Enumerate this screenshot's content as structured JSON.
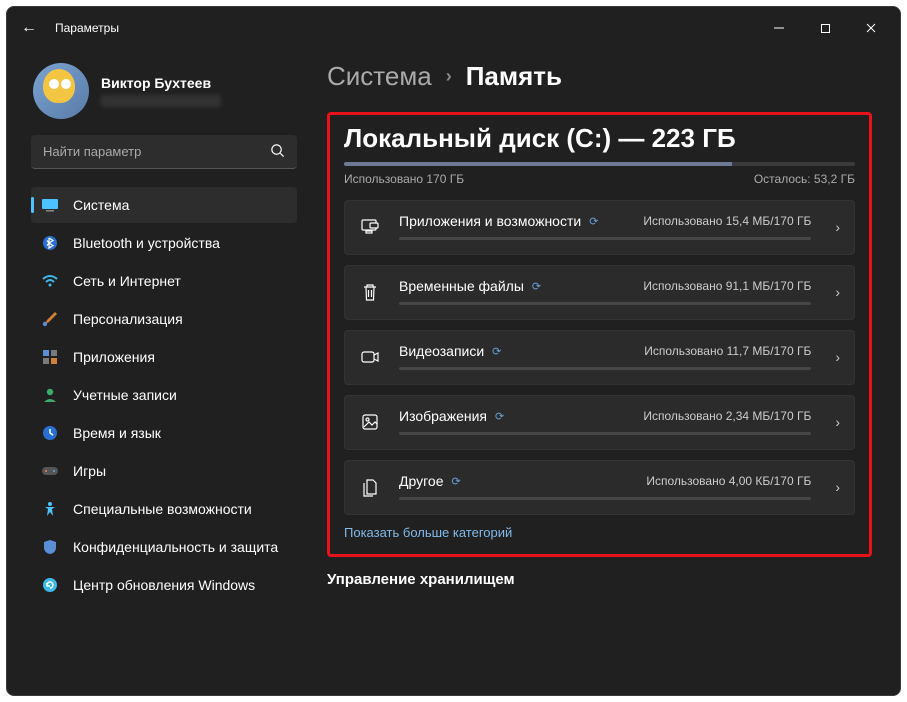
{
  "titlebar": {
    "title": "Параметры"
  },
  "profile": {
    "name": "Виктор Бухтеев"
  },
  "search": {
    "placeholder": "Найти параметр"
  },
  "sidebar": {
    "items": [
      {
        "label": "Система"
      },
      {
        "label": "Bluetooth и устройства"
      },
      {
        "label": "Сеть и Интернет"
      },
      {
        "label": "Персонализация"
      },
      {
        "label": "Приложения"
      },
      {
        "label": "Учетные записи"
      },
      {
        "label": "Время и язык"
      },
      {
        "label": "Игры"
      },
      {
        "label": "Специальные возможности"
      },
      {
        "label": "Конфиденциальность и защита"
      },
      {
        "label": "Центр обновления Windows"
      }
    ]
  },
  "breadcrumb": {
    "root": "Система",
    "page": "Память"
  },
  "disk": {
    "title": "Локальный диск (C:) — 223 ГБ",
    "used": "Использовано 170 ГБ",
    "remaining": "Осталось: 53,2 ГБ"
  },
  "categories": [
    {
      "label": "Приложения и возможности",
      "usage": "Использовано 15,4 МБ/170 ГБ"
    },
    {
      "label": "Временные файлы",
      "usage": "Использовано 91,1 МБ/170 ГБ"
    },
    {
      "label": "Видеозаписи",
      "usage": "Использовано 11,7 МБ/170 ГБ"
    },
    {
      "label": "Изображения",
      "usage": "Использовано 2,34 МБ/170 ГБ"
    },
    {
      "label": "Другое",
      "usage": "Использовано 4,00 КБ/170 ГБ"
    }
  ],
  "links": {
    "show_more": "Показать больше категорий"
  },
  "sections": {
    "storage_mgmt": "Управление хранилищем"
  }
}
